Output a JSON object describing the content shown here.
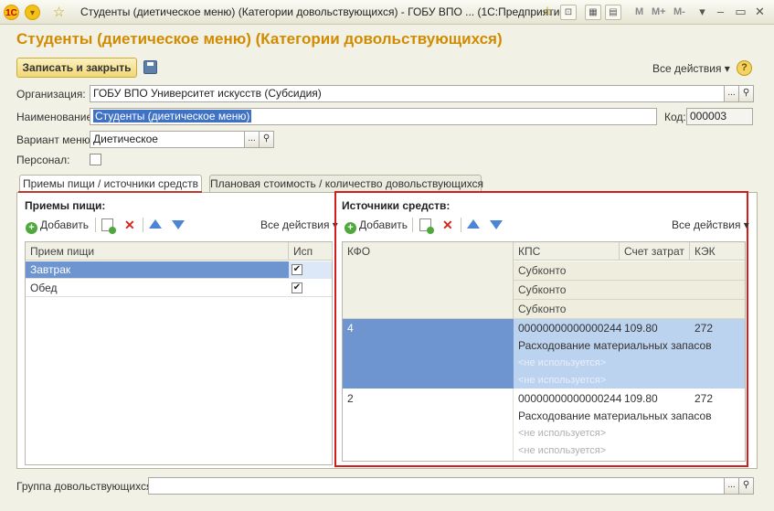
{
  "window": {
    "title": "Студенты (диетическое меню) (Категории довольствующихся) - ГОБУ ВПО ...  (1С:Предприятие)",
    "logo_text": "1С",
    "memory": [
      "M",
      "M+",
      "M-"
    ]
  },
  "form": {
    "title": "Студенты (диетическое меню) (Категории довольствующихся)",
    "save_close_label": "Записать и закрыть",
    "all_actions_label": "Все действия ▾",
    "help_label": "?",
    "fields": {
      "organization_label": "Организация:",
      "organization_value": "ГОБУ ВПО Университет искусств (Субсидия)",
      "name_label": "Наименование:",
      "name_value": "Студенты (диетическое меню)",
      "code_label": "Код:",
      "code_value": "000003",
      "menu_variant_label": "Вариант меню:",
      "menu_variant_value": "Диетическое",
      "personal_label": "Персонал:",
      "personal_checked": false,
      "group_label": "Группа довольствующихся:",
      "group_value": ""
    },
    "select_button_label": "...",
    "search_icon_glyph": "⚲"
  },
  "tabs": [
    {
      "label": "Приемы пищи / источники средств",
      "active": true
    },
    {
      "label": "Плановая стоимость / количество довольствующихся",
      "active": false
    }
  ],
  "meals": {
    "title": "Приемы пищи:",
    "add_label": "Добавить",
    "all_actions_label": "Все действия ▾",
    "columns": [
      "Прием пищи",
      "Исп"
    ],
    "rows": [
      {
        "name": "Завтрак",
        "used": true,
        "selected": true
      },
      {
        "name": "Обед",
        "used": true,
        "selected": false
      }
    ]
  },
  "sources": {
    "title": "Источники средств:",
    "add_label": "Добавить",
    "all_actions_label": "Все действия ▾",
    "columns": [
      "КФО",
      "КПС",
      "Счет затрат",
      "КЭК"
    ],
    "subconto_label": "Субконто",
    "rows": [
      {
        "kfo": "4",
        "kps": "00000000000000244",
        "account": "109.80",
        "kek": "272",
        "subconto": [
          "Расходование материальных запасов",
          "<не используется>",
          "<не используется>"
        ],
        "selected": true
      },
      {
        "kfo": "2",
        "kps": "00000000000000244",
        "account": "109.80",
        "kek": "272",
        "subconto": [
          "Расходование материальных запасов",
          "<не используется>",
          "<не используется>"
        ],
        "selected": false
      }
    ]
  },
  "colors": {
    "title_accent": "#d18b00",
    "selection": "#6e95cf",
    "selection_light": "#bcd3f0",
    "highlight_frame": "#d21d1d"
  }
}
